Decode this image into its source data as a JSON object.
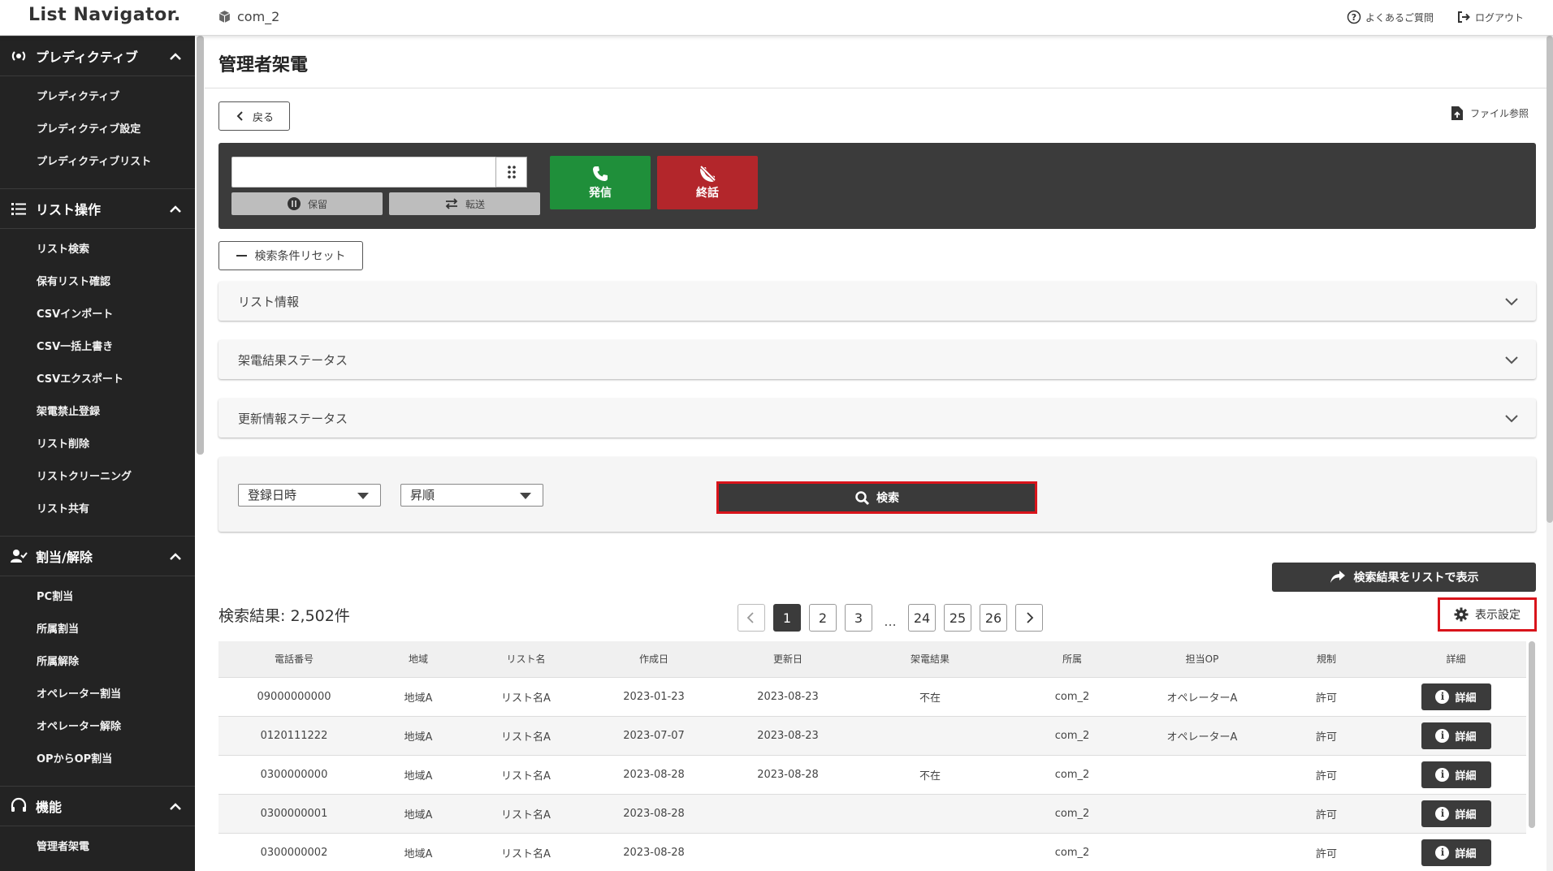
{
  "header": {
    "logo": "List Navigator.",
    "tenant": "com_2",
    "faq": "よくあるご質問",
    "logout": "ログアウト"
  },
  "sidebar": {
    "sections": [
      {
        "title": "プレディクティブ",
        "icon": "broadcast-icon",
        "items": [
          "プレディクティブ",
          "プレディクティブ設定",
          "プレディクティブリスト"
        ]
      },
      {
        "title": "リスト操作",
        "icon": "list-icon",
        "items": [
          "リスト検索",
          "保有リスト確認",
          "CSVインポート",
          "CSV一括上書き",
          "CSVエクスポート",
          "架電禁止登録",
          "リスト削除",
          "リストクリーニング",
          "リスト共有"
        ]
      },
      {
        "title": "割当/解除",
        "icon": "user-check-icon",
        "items": [
          "PC割当",
          "所属割当",
          "所属解除",
          "オペレーター割当",
          "オペレーター解除",
          "OPからOP割当"
        ]
      },
      {
        "title": "機能",
        "icon": "headset-icon",
        "items": [
          "管理者架電"
        ]
      }
    ]
  },
  "page": {
    "title": "管理者架電",
    "back": "戻る",
    "file_ref": "ファイル参照"
  },
  "phone": {
    "number_value": "",
    "hold": "保留",
    "transfer": "転送",
    "dial": "発信",
    "hangup": "終話",
    "dial_color": "#1f8f3a",
    "hangup_color": "#b3262b"
  },
  "filters": {
    "reset": "検索条件リセット",
    "accordions": [
      "リスト情報",
      "架電結果ステータス",
      "更新情報ステータス"
    ],
    "sort_field": "登録日時",
    "sort_order": "昇順",
    "search": "検索"
  },
  "results": {
    "show_as_list": "検索結果をリストで表示",
    "count": "検索結果: 2,502件",
    "display_settings": "表示設定",
    "pages": [
      "1",
      "2",
      "3"
    ],
    "ellipsis": "...",
    "last_pages": [
      "24",
      "25",
      "26"
    ],
    "current_page": "1",
    "columns": [
      "電話番号",
      "地域",
      "リスト名",
      "作成日",
      "更新日",
      "架電結果",
      "所属",
      "担当OP",
      "規制",
      "詳細"
    ],
    "detail_label": "詳細",
    "rows": [
      [
        "09000000000",
        "地域A",
        "リスト名A",
        "2023-01-23",
        "2023-08-23",
        "不在",
        "com_2",
        "オペレーターA",
        "許可"
      ],
      [
        "0120111222",
        "地域A",
        "リスト名A",
        "2023-07-07",
        "2023-08-23",
        "",
        "com_2",
        "オペレーターA",
        "許可"
      ],
      [
        "0300000000",
        "地域A",
        "リスト名A",
        "2023-08-28",
        "2023-08-28",
        "不在",
        "com_2",
        "",
        "許可"
      ],
      [
        "0300000001",
        "地域A",
        "リスト名A",
        "2023-08-28",
        "",
        "",
        "com_2",
        "",
        "許可"
      ],
      [
        "0300000002",
        "地域A",
        "リスト名A",
        "2023-08-28",
        "",
        "",
        "com_2",
        "",
        "許可"
      ]
    ]
  },
  "colors": {
    "sidebar_bg": "#232323",
    "dark_button": "#3b3b3b",
    "highlight": "#d9141b"
  }
}
